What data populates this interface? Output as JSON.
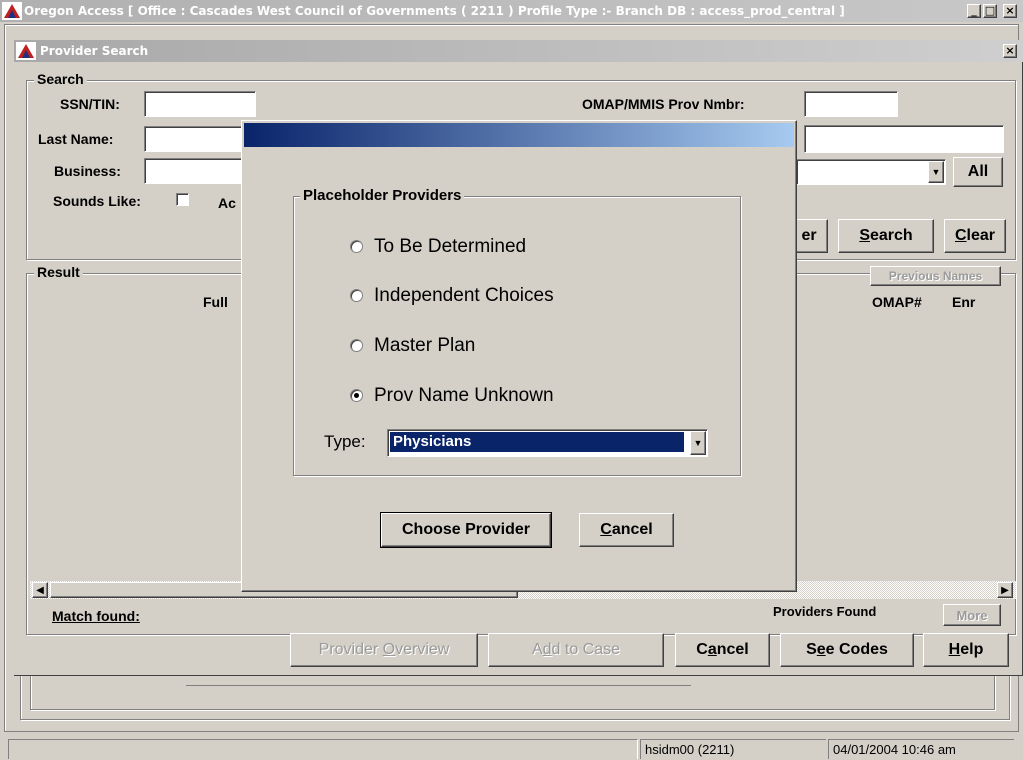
{
  "outer_window": {
    "title": "Oregon Access [ Office : Cascades West Council of Governments ( 2211 ) Profile Type :- Branch DB : access_prod_central ]",
    "min_btn": "_",
    "max_btn": "□",
    "close_btn": "×"
  },
  "provider_window": {
    "title": "Provider Search",
    "close_btn": "×"
  },
  "search_group": {
    "label": "Search",
    "ssn_label": "SSN/TIN:",
    "ssn_value": "",
    "last_name_label": "Last Name:",
    "last_name_value": "",
    "business_label": "Business:",
    "business_value": "",
    "sounds_like_label": "Sounds Like:",
    "active_label_partial": "Ac",
    "omap_label": "OMAP/MMIS Prov Nmbr:",
    "omap_value": "",
    "right_field_value": "",
    "right_dropdown_value": "",
    "all_button": "All",
    "partial_button": "er",
    "search_button_prefix": "",
    "search_button_ul": "S",
    "search_button_rest": "earch",
    "clear_button_ul": "C",
    "clear_button_rest": "lear"
  },
  "result_group": {
    "label": "Result",
    "full_col_partial": "Full",
    "previous_names_button": "Previous Names",
    "omap_col": "OMAP#",
    "enr_col": "Enr",
    "match_found_label": "Match found:",
    "providers_found_label": "Providers Found",
    "more_button": "More"
  },
  "bottom_buttons": {
    "provider_overview_pre": "Provider ",
    "provider_overview_ul": "O",
    "provider_overview_post": "verview",
    "add_to_case_pre": "A",
    "add_to_case_ul": "d",
    "add_to_case_post": "d to Case",
    "cancel_pre": "C",
    "cancel_ul": "a",
    "cancel_post": "ncel",
    "see_codes_pre": "S",
    "see_codes_ul": "e",
    "see_codes_post": "e Codes",
    "help_ul": "H",
    "help_post": "elp"
  },
  "dialog": {
    "group_label": "Placeholder Providers",
    "options": [
      {
        "label": "To Be Determined",
        "checked": false
      },
      {
        "label": "Independent Choices",
        "checked": false
      },
      {
        "label": "Master Plan",
        "checked": false
      },
      {
        "label": "Prov Name Unknown",
        "checked": true
      }
    ],
    "type_label": "Type:",
    "type_value": "Physicians",
    "choose_button": "Choose Provider",
    "cancel_ul": "C",
    "cancel_rest": "ancel"
  },
  "status_bar": {
    "user": "hsidm00 (2211)",
    "datetime": "04/01/2004 10:46 am"
  },
  "colors": {
    "face": "#d4d0c8",
    "dialog_title_start": "#0a246a",
    "dialog_title_end": "#a6caf0",
    "selection": "#0a246a"
  }
}
